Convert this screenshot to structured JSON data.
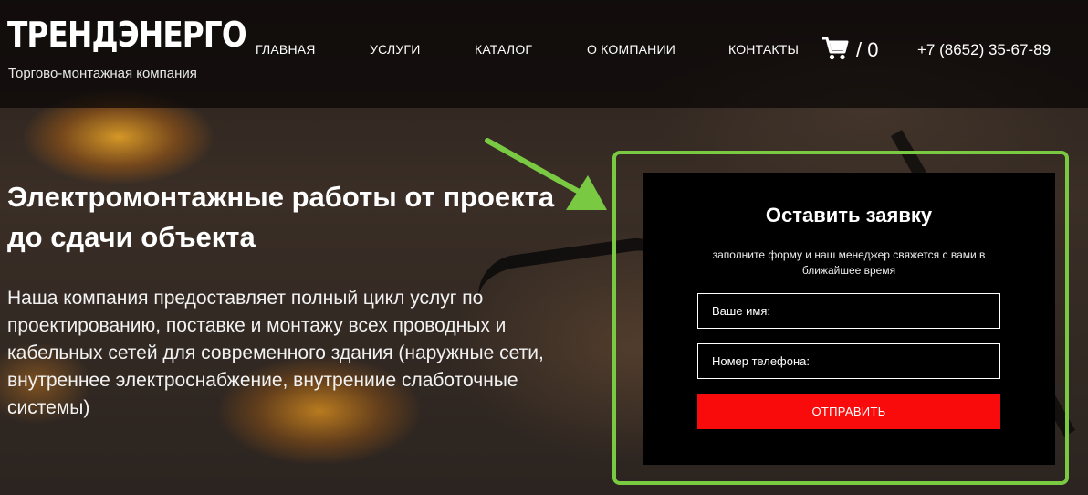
{
  "header": {
    "logo_title": "ТРЕНДЭНЕРГО",
    "logo_subtitle": "Торгово-монтажная компания",
    "nav": [
      "ГЛАВНАЯ",
      "УСЛУГИ",
      "КАТАЛОГ",
      "О КОМПАНИИ",
      "КОНТАКТЫ"
    ],
    "cart_icon": "shopping-cart-icon",
    "cart_count": "/ 0",
    "phone": "+7 (8652) 35-67-89"
  },
  "hero": {
    "title": "Электромонтажные работы от проекта до сдачи объекта",
    "description": "Наша компания предоставляет полный цикл услуг по проектированию, поставке и монтажу всех проводных и кабельных сетей для современного здания (наружные сети, внутреннее электроснабжение, внутрениие слаботочные системы)"
  },
  "form": {
    "title": "Оставить заявку",
    "subtitle": "заполните форму и наш менеджер свяжется с вами в ближайшее время",
    "name_placeholder": "Ваше имя:",
    "phone_placeholder": "Номер телефона:",
    "submit_label": "ОТПРАВИТЬ"
  },
  "colors": {
    "accent_green": "#7ac943",
    "submit_red": "#fa0b0b",
    "panel_bg": "#000000"
  }
}
